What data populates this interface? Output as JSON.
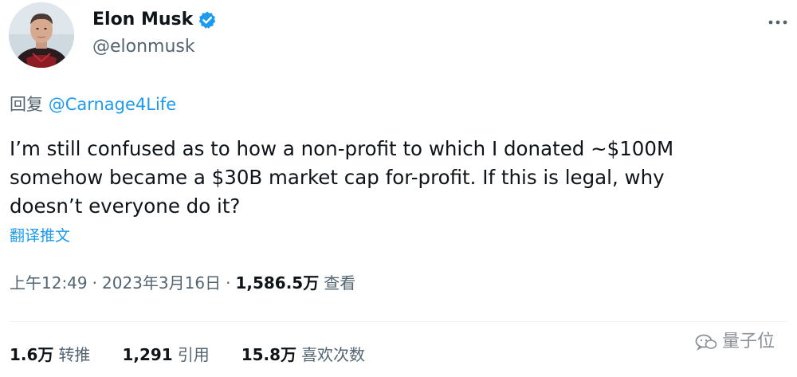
{
  "author": {
    "display_name": "Elon Musk",
    "handle": "@elonmusk",
    "verified": true,
    "avatar_icon": "profile-photo"
  },
  "reply": {
    "prefix": "回复 ",
    "target": "@Carnage4Life"
  },
  "tweet": {
    "text": "I’m still confused as to how a non-profit to which I donated ~$100M\nsomehow became a $30B market cap for-profit. If this is legal, why\ndoesn’t everyone do it?",
    "translate_label": "翻译推文"
  },
  "meta": {
    "time": "上午12:49",
    "date": "2023年3月16日",
    "views_count": "1,586.5万",
    "views_label": "查看",
    "separator": "·"
  },
  "stats": {
    "retweets": {
      "count": "1.6万",
      "label": "转推"
    },
    "quotes": {
      "count": "1,291",
      "label": "引用"
    },
    "likes": {
      "count": "15.8万",
      "label": "喜欢次数"
    }
  },
  "watermark": {
    "text": "量子位"
  },
  "colors": {
    "link": "#1d9bf0",
    "secondary": "#536471",
    "primary": "#0f1419",
    "verified": "#1d9bf0"
  }
}
